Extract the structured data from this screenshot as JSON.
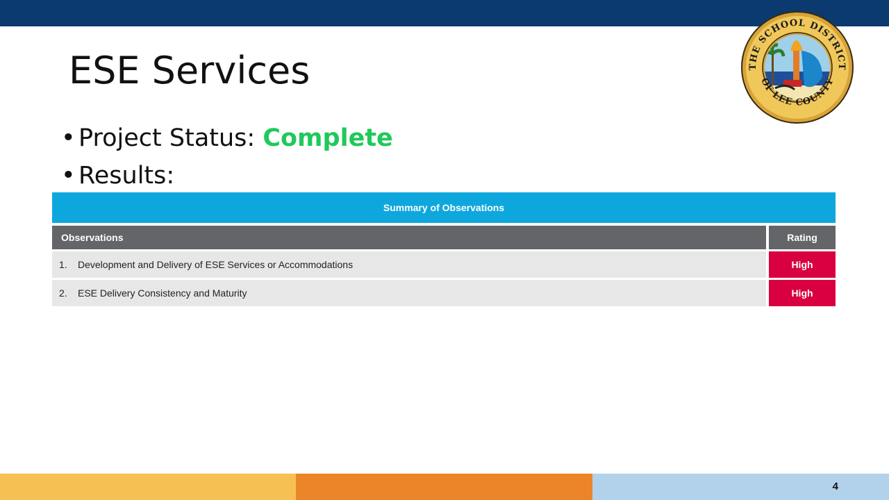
{
  "slide": {
    "title": "ESE Services",
    "page_number": "4"
  },
  "logo": {
    "name": "school-district-of-lee-county-seal",
    "text_top": "THE SCHOOL DISTRICT",
    "text_bottom": "OF LEE COUNTY"
  },
  "bullets": {
    "status_label": "Project Status: ",
    "status_value": "Complete",
    "results_label": "Results:"
  },
  "table": {
    "title": "Summary of Observations",
    "headers": {
      "observations": "Observations",
      "rating": "Rating"
    },
    "rows": [
      {
        "number": "1.",
        "observation": "Development and Delivery of ESE Services or Accommodations",
        "rating": "High"
      },
      {
        "number": "2.",
        "observation": "ESE Delivery Consistency and Maturity",
        "rating": "High"
      }
    ]
  },
  "colors": {
    "header_bar": "#0b3a70",
    "status_complete": "#1fc95a",
    "table_title_bg": "#0ea7dd",
    "column_header_bg": "#636568",
    "row_bg": "#e7e7e7",
    "rating_high": "#d8003e",
    "footer_yellow": "#f7c052",
    "footer_orange": "#ec8529",
    "footer_light_blue": "#b2d1ea"
  }
}
